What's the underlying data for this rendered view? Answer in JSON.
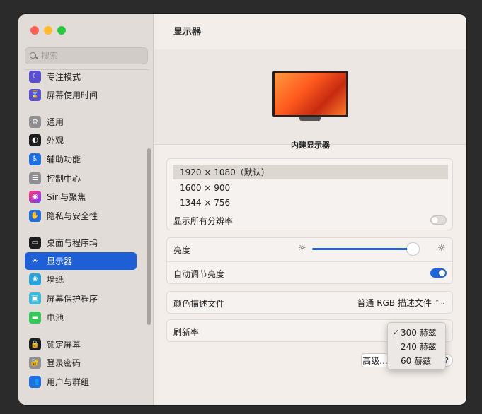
{
  "sidebar": {
    "search_placeholder": "搜索",
    "items": [
      {
        "label": "专注模式",
        "icon": "moon-icon",
        "color": "#5b4ed1"
      },
      {
        "label": "屏幕使用时间",
        "icon": "hourglass-icon",
        "color": "#5b4ed1"
      },
      {
        "label": "通用",
        "icon": "gear-icon",
        "color": "#8e8e93"
      },
      {
        "label": "外观",
        "icon": "appearance-icon",
        "color": "#1c1c1e"
      },
      {
        "label": "辅助功能",
        "icon": "accessibility-icon",
        "color": "#1f6fe0"
      },
      {
        "label": "控制中心",
        "icon": "control-center-icon",
        "color": "#8e8e93"
      },
      {
        "label": "Siri与聚焦",
        "icon": "siri-icon",
        "color": "#c23ee8"
      },
      {
        "label": "隐私与安全性",
        "icon": "hand-icon",
        "color": "#1f6fe0"
      },
      {
        "label": "桌面与程序坞",
        "icon": "dock-icon",
        "color": "#1c1c1e"
      },
      {
        "label": "显示器",
        "icon": "sun-icon",
        "color": "#1f6fe0"
      },
      {
        "label": "墙纸",
        "icon": "wallpaper-icon",
        "color": "#2aa3d8"
      },
      {
        "label": "屏幕保护程序",
        "icon": "screensaver-icon",
        "color": "#3fb9d8"
      },
      {
        "label": "电池",
        "icon": "battery-icon",
        "color": "#34c759"
      },
      {
        "label": "锁定屏幕",
        "icon": "lock-icon",
        "color": "#1c1c1e"
      },
      {
        "label": "登录密码",
        "icon": "padlock-icon",
        "color": "#8e8e93"
      },
      {
        "label": "用户与群组",
        "icon": "users-icon",
        "color": "#1f6fe0"
      }
    ]
  },
  "main": {
    "title": "显示器",
    "monitor_label": "内建显示器",
    "resolutions": [
      "1920 × 1080（默认）",
      "1600 × 900",
      "1344 × 756"
    ],
    "show_all_label": "显示所有分辨率",
    "show_all_on": false,
    "brightness_label": "亮度",
    "brightness_level": 0.9,
    "auto_brightness_label": "自动调节亮度",
    "auto_brightness_on": true,
    "color_profile_label": "颜色描述文件",
    "color_profile_value": "普通 RGB 描述文件",
    "refresh_label": "刷新率",
    "refresh_options": [
      "300 赫兹",
      "240 赫兹",
      "60 赫兹"
    ],
    "refresh_selected": "300 赫兹",
    "advanced_label": "高级...",
    "help_label": "?"
  },
  "colors": {
    "accent": "#1f5fd6"
  }
}
